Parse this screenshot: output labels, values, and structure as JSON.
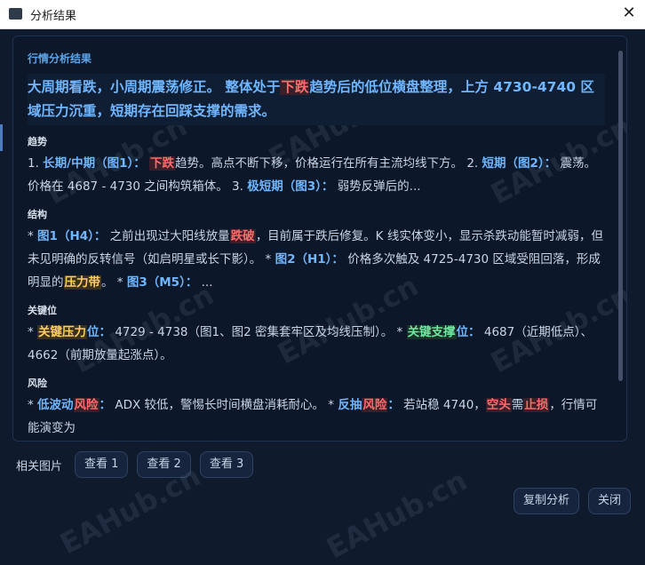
{
  "window": {
    "title": "分析结果",
    "close_glyph": "✕"
  },
  "content": {
    "section_title": "行情分析结果",
    "headline_pre": "大周期看跌，小周期震荡修正。 整体处于",
    "headline_red": "下跌",
    "headline_post": "趋势后的低位横盘整理，上方 4730-4740 区域压力沉重，短期存在回踩支撑的需求。",
    "trend_label": "趋势",
    "trend": {
      "a": "1. ",
      "b": "长期/中期（图1）：",
      "c": " ",
      "d": "下跌",
      "e": "趋势。高点不断下移，价格运行在所有主流均线下方。 2. ",
      "f": "短期（图2）：",
      "g": " 震荡。价格在 4687 - 4730 之间构筑箱体。 3. ",
      "h": "极短期（图3）：",
      "i": " 弱势反弹后的..."
    },
    "structure_label": "结构",
    "structure": {
      "a": "* ",
      "b": "图1（H4）：",
      "c": " 之前出现过大阳线放量",
      "d": "跌破",
      "e": "，目前属于跌后修复。K 线实体变小，显示杀跌动能暂时减弱，但未见明确的反转信号（如启明星或长下影）。 * ",
      "f": "图2（H1）：",
      "g": " 价格多次触及 4725-4730 区域受阻回落，形成明显的",
      "h": "压力带",
      "i": "。 * ",
      "j": "图3（M5）：",
      "k": " ..."
    },
    "keylevel_label": "关键位",
    "keylevel": {
      "a": "* ",
      "b": "关键压力",
      "c": "位：",
      "d": " 4729 - 4738（图1、图2 密集套牢区及均线压制）。 * ",
      "e": "关键支撑",
      "f": "位：",
      "g": " 4687（近期低点）、4662（前期放量起涨点）。"
    },
    "risk_label": "风险",
    "risk": {
      "a": "* ",
      "b": "低波动",
      "c": "风险",
      "d": "：",
      "e": " ADX 较低，警惕长时间横盘消耗耐心。 * ",
      "f": "反抽",
      "g": "风险",
      "h": "：",
      "i": " 若站稳 4740，",
      "j": "空头",
      "k": "需",
      "l": "止损",
      "m": "，行情可能演变为"
    }
  },
  "images": {
    "label": "相关图片",
    "buttons": [
      "查看 1",
      "查看 2",
      "查看 3"
    ]
  },
  "actions": {
    "copy": "复制分析",
    "close": "关闭"
  },
  "watermark": "EAHub.cn",
  "colors": {
    "accent": "#6fb6ff",
    "bearish": "#ff6b6b",
    "resistance": "#ffcf5c",
    "support": "#6ee7a0",
    "background": "#0f1a2c"
  }
}
